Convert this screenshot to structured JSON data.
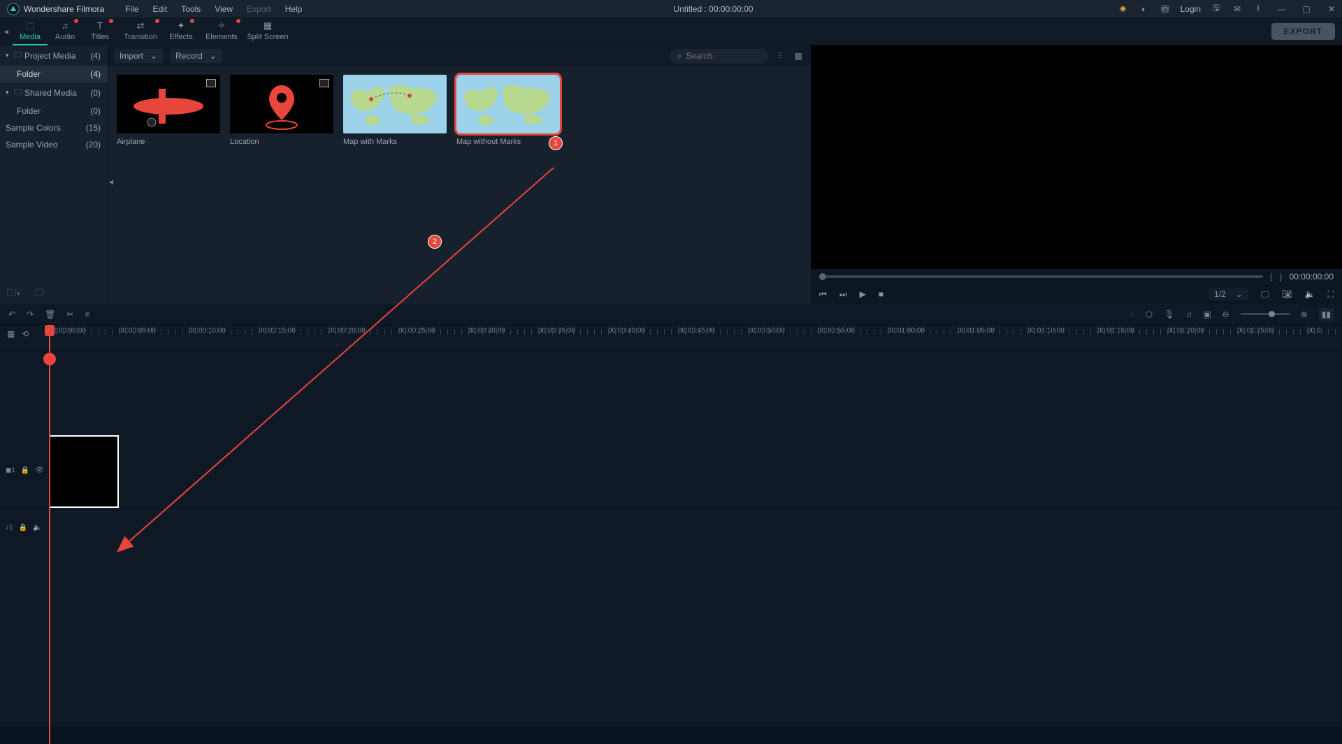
{
  "titlebar": {
    "appname": "Wondershare Filmora",
    "menus": [
      "File",
      "Edit",
      "Tools",
      "View",
      "Export",
      "Help"
    ],
    "center": "Untitled : 00:00:00:00",
    "login": "Login"
  },
  "ribbon": {
    "tabs": [
      {
        "label": "Media",
        "icon": "🗀",
        "active": true,
        "dot": false
      },
      {
        "label": "Audio",
        "icon": "♫",
        "dot": true
      },
      {
        "label": "Titles",
        "icon": "T",
        "dot": true
      },
      {
        "label": "Transition",
        "icon": "⇄",
        "dot": true,
        "wide": true
      },
      {
        "label": "Effects",
        "icon": "✦",
        "dot": true
      },
      {
        "label": "Elements",
        "icon": "✧",
        "dot": true,
        "wide": true
      },
      {
        "label": "Split Screen",
        "icon": "▦",
        "dot": false,
        "wide": true
      }
    ],
    "export": "EXPORT"
  },
  "sidebar": {
    "rows": [
      {
        "label": "Project Media",
        "count": "(4)",
        "group": true,
        "icon": "🗀"
      },
      {
        "label": "Folder",
        "count": "(4)",
        "active": true,
        "indent": true
      },
      {
        "label": "Shared Media",
        "count": "(0)",
        "group": true,
        "icon": "🗀"
      },
      {
        "label": "Folder",
        "count": "(0)",
        "indent": true
      },
      {
        "label": "Sample Colors",
        "count": "(15)"
      },
      {
        "label": "Sample Video",
        "count": "(20)"
      }
    ]
  },
  "gallery": {
    "import": "Import",
    "record": "Record",
    "search": "Search",
    "items": [
      {
        "name": "Airplane",
        "kind": "airplane"
      },
      {
        "name": "Location",
        "kind": "location"
      },
      {
        "name": "Map with Marks",
        "kind": "map-marks"
      },
      {
        "name": "Map without Marks",
        "kind": "map",
        "highlight": true,
        "num": "1"
      }
    ]
  },
  "annotation": {
    "step2": "2"
  },
  "preview": {
    "time": "00:00:00:00",
    "ratio": "1/2"
  },
  "ruler": [
    "00:00:00:00",
    "00:00:05:00",
    "00:00:10:00",
    "00:00:15:00",
    "00:00:20:00",
    "00:00:25:00",
    "00:00:30:00",
    "00:00:35:00",
    "00:00:40:00",
    "00:00:45:00",
    "00:00:50:00",
    "00:00:55:00",
    "00:01:00:00",
    "00:01:05:00",
    "00:01:10:00",
    "00:01:15:00",
    "00:01:20:00",
    "00:01:25:00",
    "00:0"
  ],
  "tracks": {
    "video": "◼1",
    "audio": "♪1"
  }
}
